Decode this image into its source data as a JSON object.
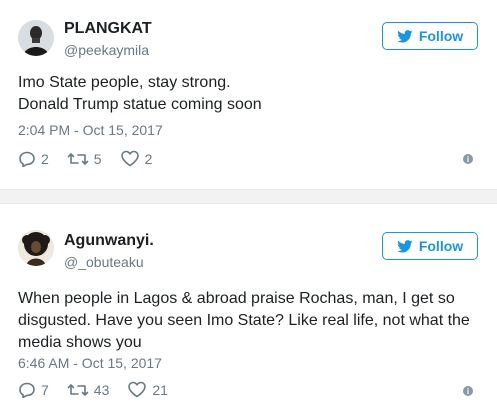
{
  "tweets": [
    {
      "name": "PLANGKAT",
      "handle": "@peekaymila",
      "follow_label": "Follow",
      "text_lines": [
        "Imo State people, stay strong.",
        "Donald Trump statue coming soon"
      ],
      "timestamp": "2:04 PM - Oct 15, 2017",
      "replies": "2",
      "retweets": "5",
      "likes": "2",
      "info": "i"
    },
    {
      "name": "Agunwanyi.",
      "handle": "@_obuteaku",
      "follow_label": "Follow",
      "text_lines": [
        "When people in Lagos & abroad praise Rochas, man, I get so disgusted. Have you seen Imo State? Like real life, not what the media shows you"
      ],
      "timestamp": "6:46 AM - Oct 15, 2017",
      "replies": "7",
      "retweets": "43",
      "likes": "21",
      "info": "i"
    }
  ],
  "colors": {
    "accent": "#1b95e0",
    "secondary_text": "#697882",
    "separator": "#f2f2f2"
  },
  "icons": [
    "twitter-bird-icon",
    "reply-icon",
    "retweet-icon",
    "like-icon",
    "info-icon"
  ]
}
